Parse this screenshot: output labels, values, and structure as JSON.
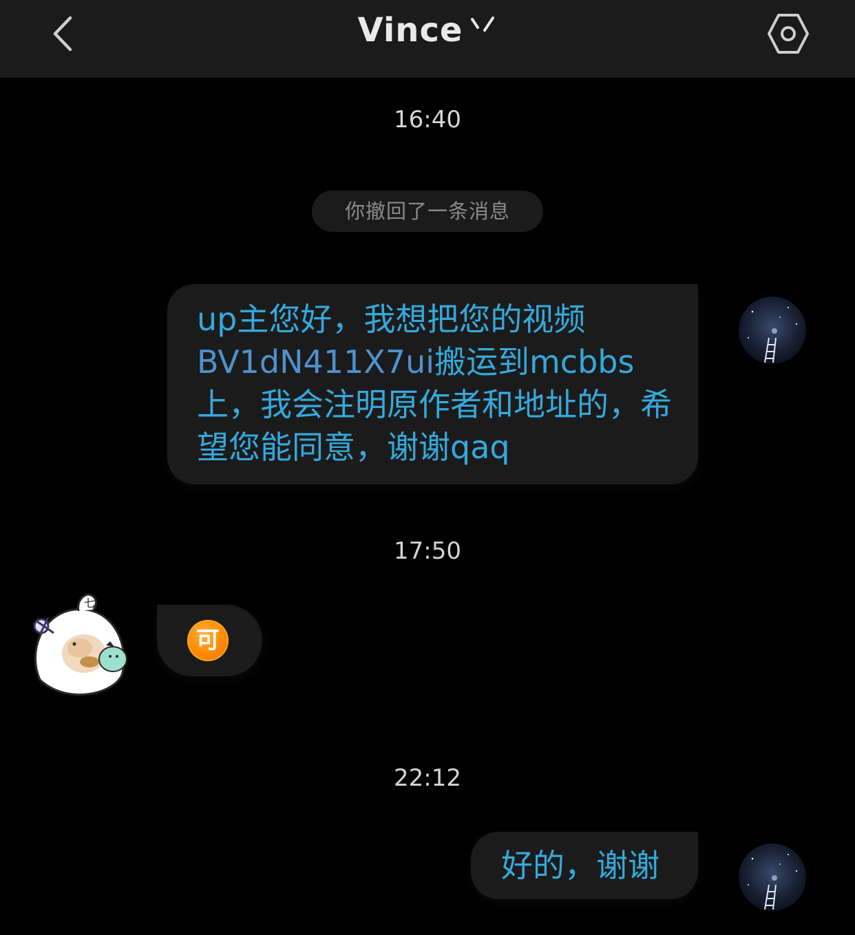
{
  "header": {
    "title": "Vince",
    "back_icon": "chevron-left-icon",
    "settings_icon": "hexagon-settings-icon"
  },
  "conversation": {
    "timestamps": [
      "16:40",
      "17:50",
      "22:12"
    ],
    "recall_notice": "你撤回了一条消息",
    "messages": [
      {
        "sender": "self",
        "text_before_link": "up主您好，我想把您的视频",
        "link": "BV1dN411X7ui",
        "text_after_link": "搬运到mcbbs上，我会注明原作者和地址的，希望您能同意，谢谢qaq"
      },
      {
        "sender": "other",
        "emoji": "可"
      },
      {
        "sender": "self",
        "text": "好的，谢谢"
      }
    ]
  },
  "colors": {
    "background": "#000000",
    "header": "#1b1b1b",
    "bubble": "#1b1b1b",
    "message_text": "#35a9dc",
    "link_text": "#4e92cf",
    "timestamp": "#d6d6d6",
    "emoji_orange": "#ff8a00"
  }
}
